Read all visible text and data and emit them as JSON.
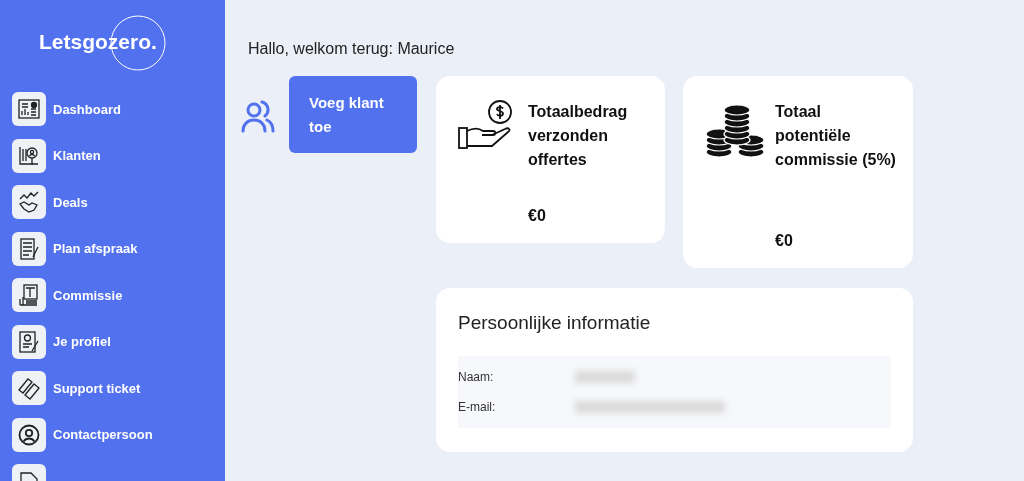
{
  "sidebar": {
    "logo": "Letsgozero.",
    "items": [
      {
        "label": "Dashboard"
      },
      {
        "label": "Klanten"
      },
      {
        "label": "Deals"
      },
      {
        "label": "Plan afspraak"
      },
      {
        "label": "Commissie"
      },
      {
        "label": "Je profiel"
      },
      {
        "label": "Support ticket"
      },
      {
        "label": "Contactpersoon"
      }
    ]
  },
  "greeting": "Hallo, welkom terug: Maurice",
  "add_client_button": "Voeg klant toe",
  "stats": [
    {
      "title": "Totaalbedrag verzonden offertes",
      "value": "€0"
    },
    {
      "title": "Totaal potentiële commissie (5%)",
      "value": "€0"
    }
  ],
  "personal_info": {
    "title": "Persoonlijke informatie",
    "fields": [
      {
        "label": "Naam:",
        "redacted": true
      },
      {
        "label": "E-mail:",
        "redacted": true
      }
    ]
  }
}
